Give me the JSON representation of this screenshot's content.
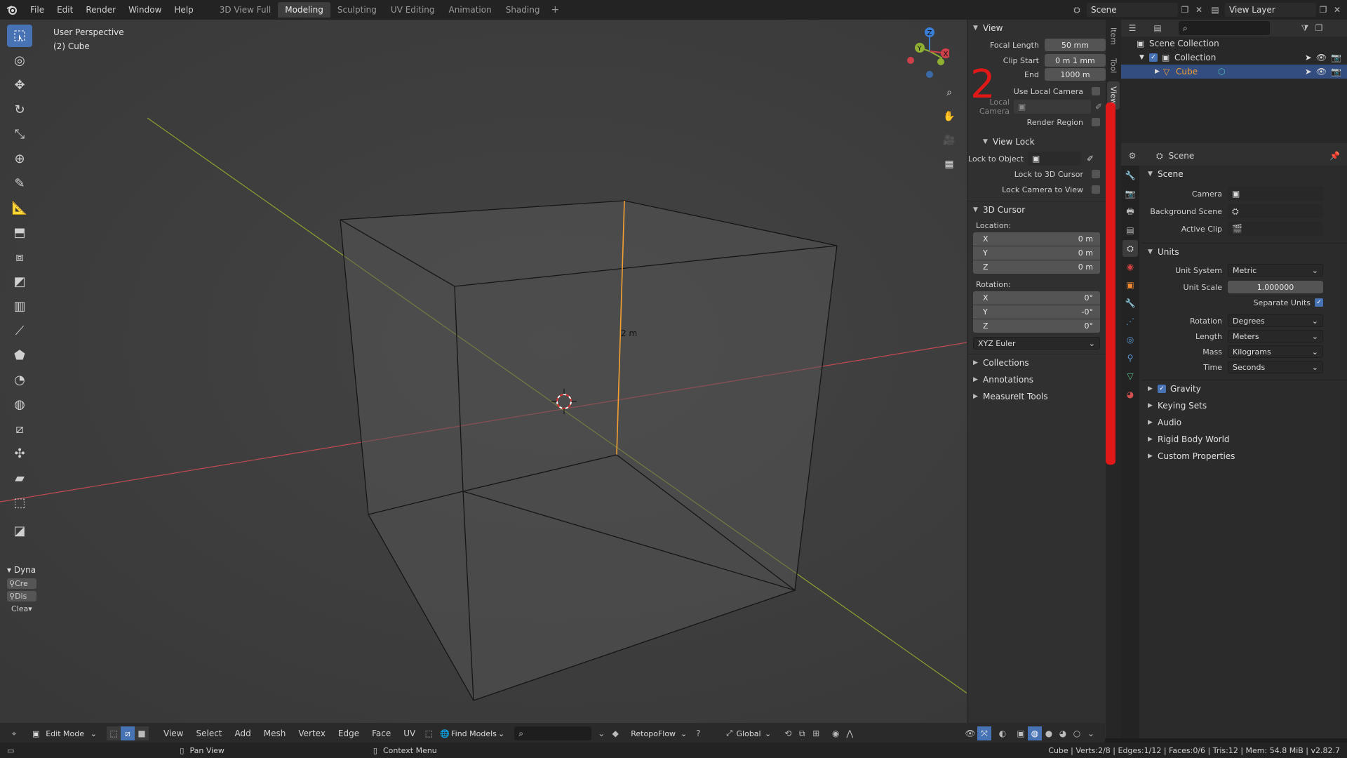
{
  "topbar": {
    "menu": [
      "File",
      "Edit",
      "Render",
      "Window",
      "Help"
    ],
    "workspaces": [
      "3D View Full",
      "Modeling",
      "Sculpting",
      "UV Editing",
      "Animation",
      "Shading"
    ],
    "active_workspace": "Modeling",
    "scene_name": "Scene",
    "view_layer": "View Layer"
  },
  "viewport": {
    "perspective": "User Perspective",
    "object": "(2) Cube",
    "edge_length": "2 m",
    "dyna_label": "Dyna",
    "dyna_items": [
      "Cre",
      "Dis",
      "Clea"
    ]
  },
  "npanel": {
    "tabs": [
      "Item",
      "Tool",
      "View"
    ],
    "view": {
      "title": "View",
      "focal_length_label": "Focal Length",
      "focal_length": "50 mm",
      "clip_start_label": "Clip Start",
      "clip_start": "0 m 1 mm",
      "end_label": "End",
      "end": "1000 m",
      "use_local_camera": "Use Local Camera",
      "local_camera": "Local Camera",
      "render_region": "Render Region"
    },
    "view_lock": {
      "title": "View Lock",
      "lock_to_object": "Lock to Object",
      "lock_to_cursor": "Lock to 3D Cursor",
      "lock_camera": "Lock Camera to View"
    },
    "cursor": {
      "title": "3D Cursor",
      "location_label": "Location:",
      "loc": [
        {
          "axis": "X",
          "val": "0 m"
        },
        {
          "axis": "Y",
          "val": "0 m"
        },
        {
          "axis": "Z",
          "val": "0 m"
        }
      ],
      "rotation_label": "Rotation:",
      "rot": [
        {
          "axis": "X",
          "val": "0°"
        },
        {
          "axis": "Y",
          "val": "-0°"
        },
        {
          "axis": "Z",
          "val": "0°"
        }
      ],
      "mode": "XYZ Euler"
    },
    "collapsed": [
      "Collections",
      "Annotations",
      "MeasureIt Tools"
    ]
  },
  "outliner": {
    "root": "Scene Collection",
    "collection": "Collection",
    "object": "Cube"
  },
  "properties": {
    "context": "Scene",
    "scene_panel": "Scene",
    "camera_label": "Camera",
    "bg_scene_label": "Background Scene",
    "active_clip_label": "Active Clip",
    "units_panel": "Units",
    "unit_system_label": "Unit System",
    "unit_system": "Metric",
    "unit_scale_label": "Unit Scale",
    "unit_scale": "1.000000",
    "separate_units": "Separate Units",
    "rotation_label": "Rotation",
    "rotation": "Degrees",
    "length_label": "Length",
    "length": "Meters",
    "mass_label": "Mass",
    "mass": "Kilograms",
    "time_label": "Time",
    "time": "Seconds",
    "gravity": "Gravity",
    "collapsed": [
      "Keying Sets",
      "Audio",
      "Rigid Body World",
      "Custom Properties"
    ]
  },
  "header3d": {
    "mode": "Edit Mode",
    "menus": [
      "View",
      "Select",
      "Add",
      "Mesh",
      "Vertex",
      "Edge",
      "Face",
      "UV"
    ],
    "find_models": "Find Models",
    "retopoflow": "RetopoFlow",
    "orientation": "Global"
  },
  "statusbar": {
    "pan": "Pan View",
    "context": "Context Menu",
    "stats": "Cube | Verts:2/8 | Edges:1/12 | Faces:0/6 | Tris:12 | Mem: 54.8 MiB | v2.82.7"
  },
  "annotations": {
    "one": "1",
    "two": "2"
  },
  "colors": {
    "accent": "#4772b3",
    "red_annotation": "#e01818",
    "x_axis": "#d0404a",
    "y_axis": "#8fb032"
  }
}
